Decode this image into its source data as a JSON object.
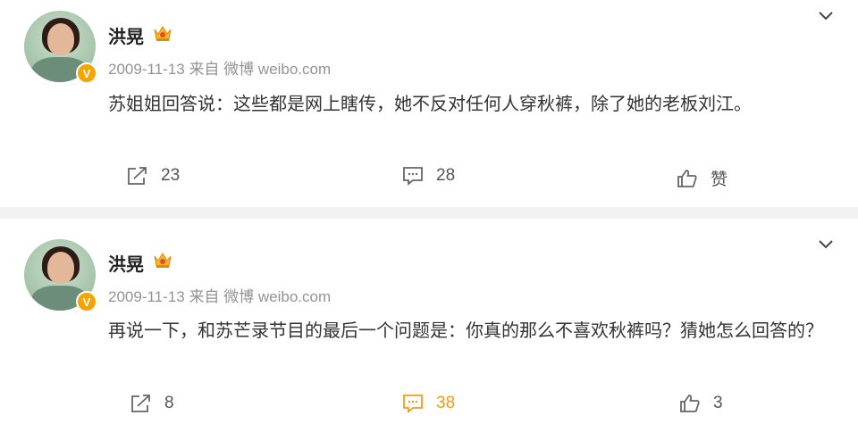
{
  "posts": [
    {
      "author": "洪晃",
      "timestamp": "2009-11-13",
      "source": "来自 微博 weibo.com",
      "text": "苏姐姐回答说：这些都是网上瞎传，她不反对任何人穿秋裤，除了她的老板刘江。",
      "shares": "23",
      "comments": "28",
      "likes": "赞",
      "comment_active": false
    },
    {
      "author": "洪晃",
      "timestamp": "2009-11-13",
      "source": "来自 微博 weibo.com",
      "text": "再说一下，和苏芒录节目的最后一个问题是：你真的那么不喜欢秋裤吗？猜她怎么回答的？",
      "shares": "8",
      "comments": "38",
      "likes": "3",
      "comment_active": true
    }
  ],
  "colors": {
    "accent_orange": "#f59b1a",
    "verified_badge": "#f5a400",
    "meta_gray": "#939393",
    "separator": "#f2f2f2"
  },
  "icons": {
    "verified": "verified-v-icon",
    "member": "crown-icon",
    "menu": "chevron-down-icon",
    "share": "share-icon",
    "comment": "comment-icon",
    "like": "thumbs-up-icon"
  }
}
